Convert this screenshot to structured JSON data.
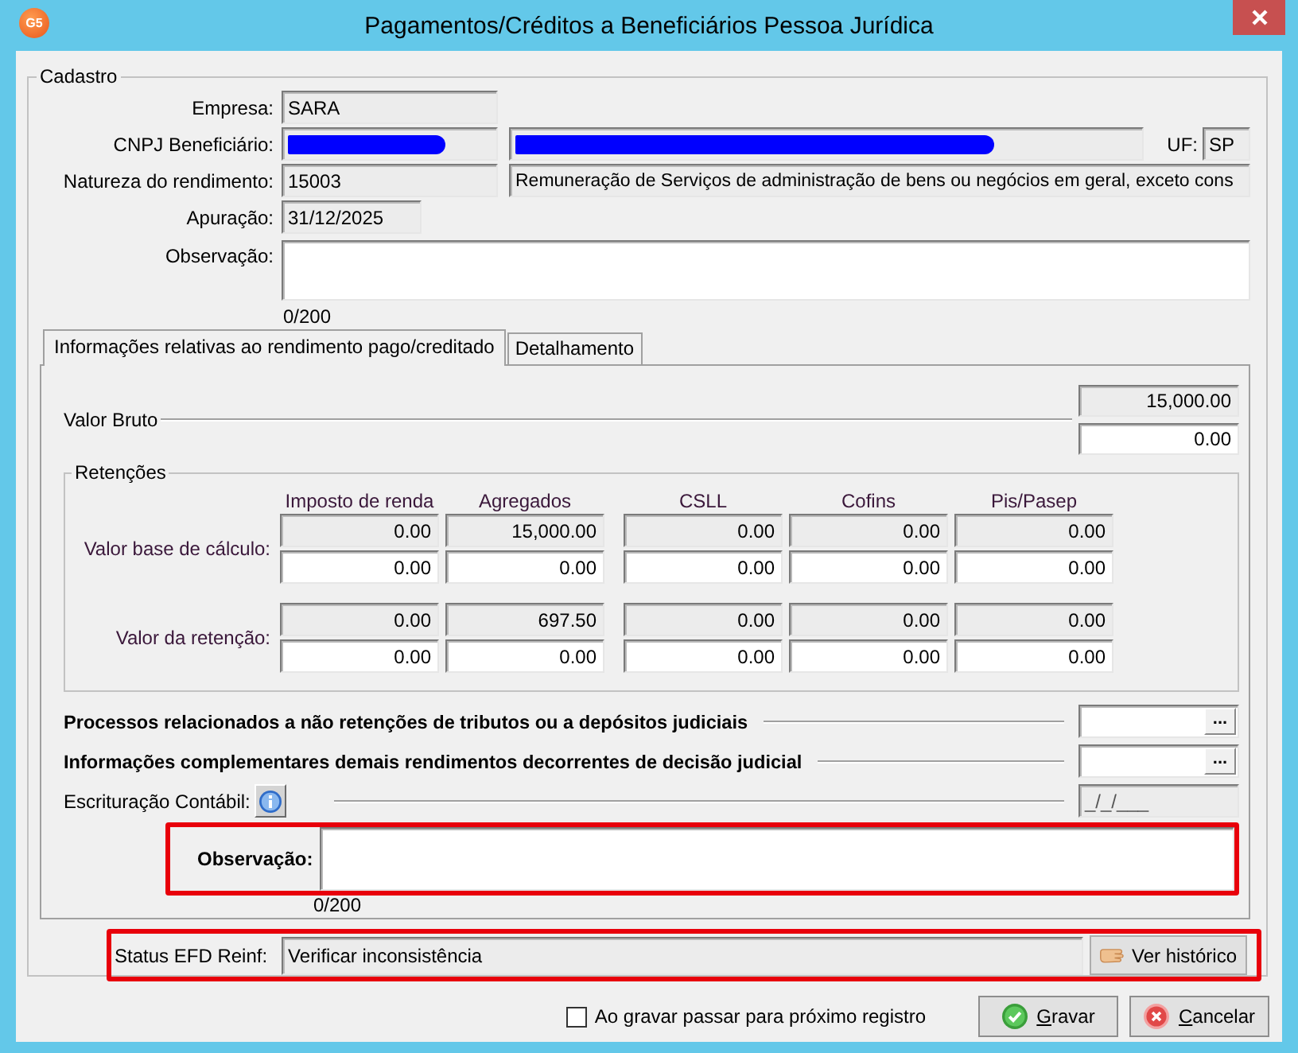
{
  "window": {
    "logo_text": "G5",
    "title": "Pagamentos/Créditos a Beneficiários Pessoa Jurídica"
  },
  "cadastro": {
    "legend": "Cadastro",
    "rows": [
      {
        "label": "Empresa:",
        "fields": [
          {
            "kind": "code",
            "value": "SARA",
            "readonly": true,
            "redacted": false
          }
        ]
      },
      {
        "label": "CNPJ Beneficiário:",
        "fields": [
          {
            "kind": "code",
            "readonly": true,
            "redacted": true
          },
          {
            "kind": "description",
            "readonly": true,
            "redacted": true
          },
          {
            "kind": "uf",
            "label": "UF:",
            "value": "SP",
            "readonly": true,
            "redacted": false
          }
        ]
      },
      {
        "label": "Natureza do rendimento:",
        "fields": [
          {
            "kind": "code",
            "value": "15003",
            "readonly": true,
            "redacted": false
          },
          {
            "kind": "description",
            "value": "Remuneração de Serviços de administração de bens ou negócios em geral, exceto cons",
            "readonly": true,
            "redacted": false
          }
        ]
      },
      {
        "label": "Apuração:",
        "fields": [
          {
            "kind": "date",
            "value": "31/12/2025",
            "readonly": true,
            "redacted": false
          }
        ]
      },
      {
        "label": "Observação:",
        "fields": [
          {
            "kind": "memo",
            "counter": "0/200",
            "readonly": false,
            "redacted": false
          }
        ]
      }
    ]
  },
  "tabs": [
    {
      "label": "Informações relativas ao rendimento pago/creditado",
      "selected": true
    },
    {
      "label": "Detalhamento",
      "selected": false
    }
  ],
  "panel": {
    "valor_bruto": {
      "label": "Valor Bruto",
      "fields": [
        {
          "value": "15,000.00",
          "readonly": true
        },
        {
          "value": "0.00",
          "readonly": false
        }
      ]
    },
    "retencoes": {
      "legend": "Retenções",
      "columns": [
        "Imposto de renda",
        "Agregados",
        "CSLL",
        "Cofins",
        "Pis/Pasep"
      ],
      "rows": [
        {
          "label": "Valor base de cálculo:",
          "lines": [
            {
              "kind": "readonly",
              "values": [
                "0.00",
                "15,000.00",
                "0.00",
                "0.00",
                "0.00"
              ]
            },
            {
              "kind": "editable",
              "values": [
                "0.00",
                "0.00",
                "0.00",
                "0.00",
                "0.00"
              ]
            }
          ]
        },
        {
          "label": "Valor da retenção:",
          "lines": [
            {
              "kind": "readonly",
              "values": [
                "0.00",
                "697.50",
                "0.00",
                "0.00",
                "0.00"
              ]
            },
            {
              "kind": "editable",
              "values": [
                "0.00",
                "0.00",
                "0.00",
                "0.00",
                "0.00"
              ]
            }
          ]
        }
      ]
    },
    "lookups": [
      {
        "kind": "lookup",
        "label": "Processos relacionados a não retenções de tributos ou a depósitos judiciais",
        "button": "..."
      },
      {
        "kind": "lookup",
        "label": "Informações complementares demais rendimentos decorrentes de decisão judicial",
        "button": "..."
      },
      {
        "kind": "date",
        "label": "Escrituração Contábil:",
        "value": "_/_/___"
      }
    ],
    "observacao": {
      "label": "Observação:",
      "counter": "0/200",
      "highlighted": true
    }
  },
  "status": {
    "label": "Status EFD Reinf:",
    "value": "Verificar inconsistência",
    "button": "Ver histórico",
    "highlighted": true
  },
  "footer": {
    "checkbox": {
      "label": "Ao gravar passar para próximo registro",
      "checked": false
    },
    "buttons": [
      {
        "kind": "save",
        "label": "Gravar",
        "mnemonic": true
      },
      {
        "kind": "cancel",
        "label": "Cancelar",
        "mnemonic": true
      }
    ]
  }
}
